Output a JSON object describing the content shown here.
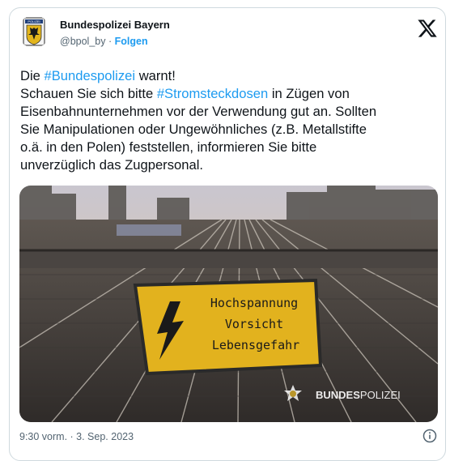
{
  "account": {
    "name": "Bundespolizei Bayern",
    "handle": "@bpol_by",
    "separator": "·",
    "follow_label": "Folgen",
    "badge_text": "POLIZEI"
  },
  "icons": {
    "avatar": "federal-eagle-badge",
    "brand": "x-logo",
    "info": "info-icon"
  },
  "tweet": {
    "line1_prefix": "Die ",
    "line1_hashtag": "#Bundespolizei",
    "line1_suffix": " warnt!",
    "line2_prefix": "Schauen Sie sich bitte ",
    "line2_hashtag": "#Stromsteckdosen",
    "line2_suffix": " in Zügen von",
    "line3": "Eisenbahnunternehmen vor der Verwendung gut an. Sollten",
    "line4": "Sie Manipulationen oder Ungewöhnliches (z.B. Metallstifte",
    "line5": "o.ä. in den Polen) feststellen, informieren Sie bitte",
    "line6": "unverzüglich das Zugpersonal."
  },
  "photo": {
    "sign_line1": "Hochspannung",
    "sign_line2": "Vorsicht",
    "sign_line3": "Lebensgefahr",
    "watermark_bold": "BUNDES",
    "watermark_light": "POLIZEI"
  },
  "footer": {
    "timestamp": "9:30 vorm. · 3. Sep. 2023"
  },
  "colors": {
    "accent": "#1d9bf0",
    "text": "#0f1419",
    "muted": "#536471",
    "sign_yellow": "#e8b81c"
  }
}
